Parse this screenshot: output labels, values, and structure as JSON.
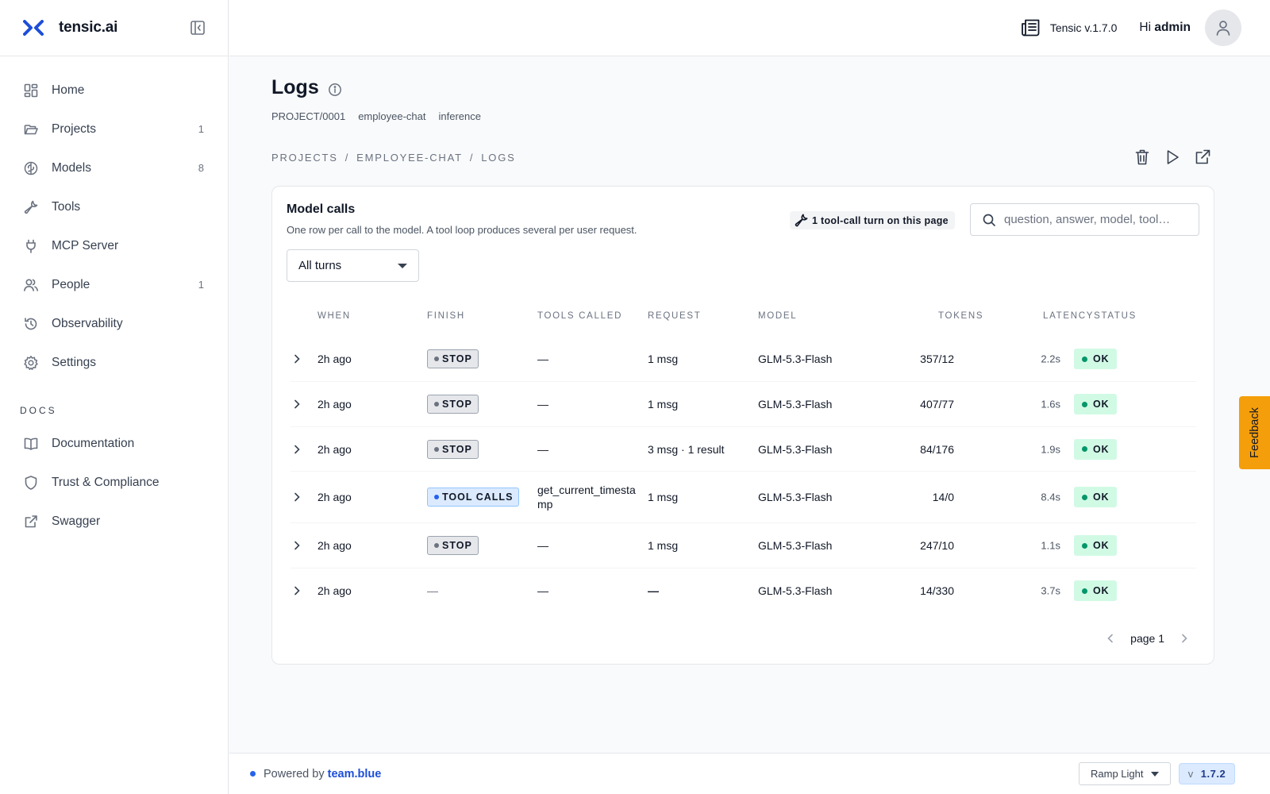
{
  "brand": {
    "name": "tensic.ai"
  },
  "sidebar": {
    "items": [
      {
        "label": "Home",
        "count": ""
      },
      {
        "label": "Projects",
        "count": "1"
      },
      {
        "label": "Models",
        "count": "8"
      },
      {
        "label": "Tools",
        "count": ""
      },
      {
        "label": "MCP Server",
        "count": ""
      },
      {
        "label": "People",
        "count": "1"
      },
      {
        "label": "Observability",
        "count": ""
      },
      {
        "label": "Settings",
        "count": ""
      }
    ],
    "docs_title": "DOCS",
    "docs_items": [
      {
        "label": "Documentation"
      },
      {
        "label": "Trust & Compliance"
      },
      {
        "label": "Swagger"
      }
    ]
  },
  "topbar": {
    "version": "Tensic v.1.7.0",
    "greeting": "Hi",
    "user": "admin"
  },
  "page": {
    "title": "Logs",
    "meta": [
      "PROJECT/0001",
      "employee-chat",
      "inference"
    ],
    "breadcrumbs": [
      "PROJECTS",
      "EMPLOYEE-CHAT",
      "LOGS"
    ],
    "breadcrumb_sep": "/"
  },
  "card": {
    "title": "Model calls",
    "subtitle": "One row per call to the model. A tool loop produces several per user request.",
    "tool_turn_badge": "1 tool-call turn on this page",
    "search_placeholder": "question, answer, model, tool…",
    "filter": "All turns",
    "columns": {
      "when": "WHEN",
      "finish": "FINISH",
      "tools": "TOOLS CALLED",
      "request": "REQUEST",
      "model": "MODEL",
      "tokens": "TOKENS",
      "latency": "LATENCY",
      "status": "STATUS"
    },
    "rows": [
      {
        "when": "2h ago",
        "finish": "STOP",
        "finish_kind": "stop",
        "tools": "—",
        "request": "1 msg",
        "model": "GLM-5.3-Flash",
        "tokens": "357/12",
        "latency": "2.2s",
        "status": "OK"
      },
      {
        "when": "2h ago",
        "finish": "STOP",
        "finish_kind": "stop",
        "tools": "—",
        "request": "1 msg",
        "model": "GLM-5.3-Flash",
        "tokens": "407/77",
        "latency": "1.6s",
        "status": "OK"
      },
      {
        "when": "2h ago",
        "finish": "STOP",
        "finish_kind": "stop",
        "tools": "—",
        "request": "3 msg · 1 result",
        "model": "GLM-5.3-Flash",
        "tokens": "84/176",
        "latency": "1.9s",
        "status": "OK"
      },
      {
        "when": "2h ago",
        "finish": "TOOL CALLS",
        "finish_kind": "tool",
        "tools": "get_current_timestamp",
        "request": "1 msg",
        "model": "GLM-5.3-Flash",
        "tokens": "14/0",
        "latency": "8.4s",
        "status": "OK"
      },
      {
        "when": "2h ago",
        "finish": "STOP",
        "finish_kind": "stop",
        "tools": "—",
        "request": "1 msg",
        "model": "GLM-5.3-Flash",
        "tokens": "247/10",
        "latency": "1.1s",
        "status": "OK"
      },
      {
        "when": "2h ago",
        "finish": "—",
        "finish_kind": "none",
        "tools": "—",
        "request": "—",
        "model": "GLM-5.3-Flash",
        "tokens": "14/330",
        "latency": "3.7s",
        "status": "OK"
      }
    ],
    "pager": "page 1"
  },
  "feedback": "Feedback",
  "footer": {
    "powered_prefix": "Powered by",
    "powered_link": "team.blue",
    "theme": "Ramp Light",
    "version_prefix": "v",
    "version": "1.7.2"
  },
  "colors": {
    "accent": "#1d4ed8",
    "ok": "#d1fae5",
    "feedback": "#f59e0b"
  }
}
